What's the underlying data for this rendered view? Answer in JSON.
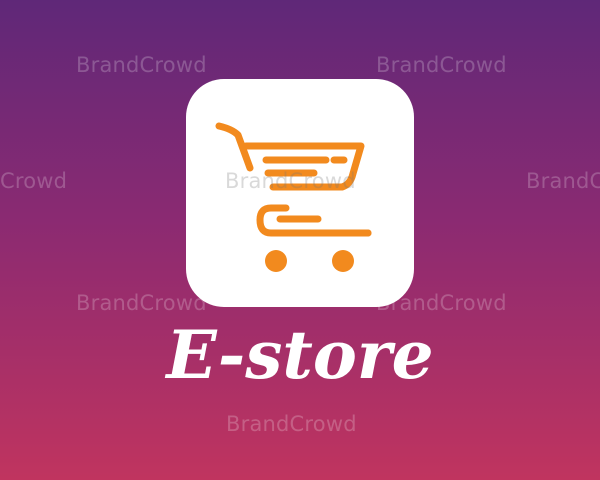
{
  "brand": {
    "name": "E-store"
  },
  "icon": {
    "name": "shopping-cart-icon",
    "color": "#f28a1e",
    "tile_color": "#ffffff"
  },
  "watermark": {
    "text": "BrandCrowd",
    "partial_text": "Crowd"
  },
  "colors": {
    "gradient_top": "#5f2878",
    "gradient_bottom": "#c0345f"
  }
}
